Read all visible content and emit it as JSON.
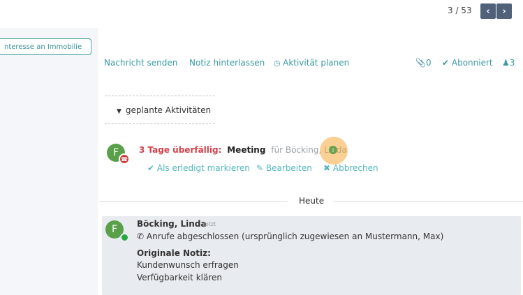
{
  "pager": {
    "counter": "3 / 53",
    "prev_icon": "chevron-left-icon",
    "next_icon": "chevron-right-icon"
  },
  "left": {
    "tag_label": "nteresse an Immobilie"
  },
  "chatter": {
    "send_message": "Nachricht senden",
    "log_note": "Notiz hinterlassen",
    "schedule_activity": "Aktivität planen",
    "attachments": "0",
    "follow": "Abonniert",
    "followers": "3"
  },
  "planned": {
    "toggle_label": "geplante Aktivitäten",
    "activity": {
      "avatar_initial": "F",
      "overdue": "3 Tage überfällig:",
      "summary": "Meeting",
      "for_label": "für Böcking, Linda",
      "mark_done": "Als erledigt markieren",
      "edit": "Bearbeiten",
      "cancel": "Abbrechen"
    }
  },
  "today_label": "Heute",
  "message": {
    "avatar_initial": "F",
    "author": "Böcking, Linda",
    "time": "- Jetzt",
    "line1": "Anrufe abgeschlossen (ursprünglich zugewiesen an Mustermann, Max)",
    "note_title": "Originale Notiz:",
    "note_line1": "Kundenwunsch erfragen",
    "note_line2": "Verfügbarkeit klären"
  },
  "colors": {
    "accent": "#3a9aa0",
    "overdue": "#d6404a",
    "pager": "#51617a",
    "avatar": "#5aa04a"
  }
}
